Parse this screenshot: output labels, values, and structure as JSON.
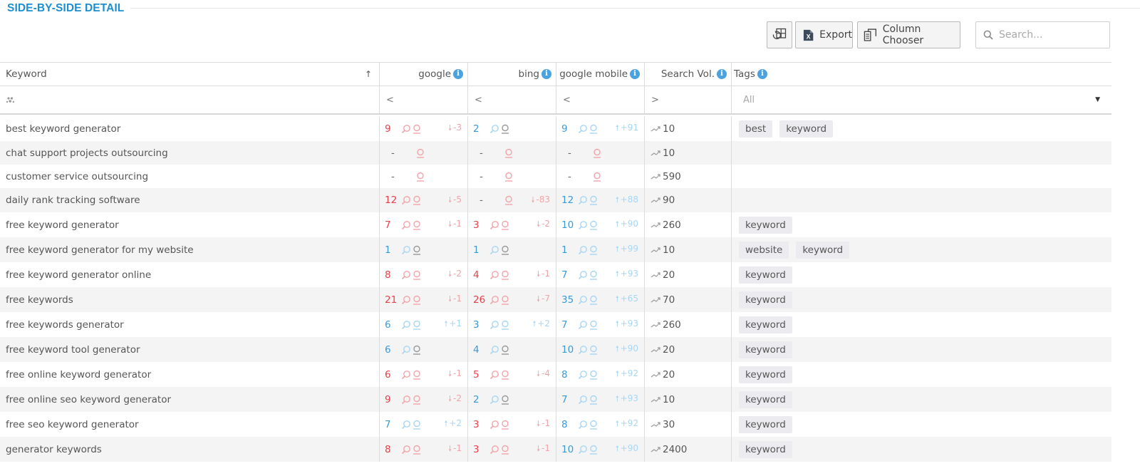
{
  "title": "SIDE-BY-SIDE DETAIL",
  "toolbar": {
    "export_label": "Export",
    "column_chooser_label": "Column Chooser",
    "search_placeholder": "Search..."
  },
  "colors": {
    "accent": "#1b8fd1",
    "worse": "#e8404a",
    "better": "#3a9ad9",
    "info": "#4aa3df"
  },
  "columns": {
    "keyword": "Keyword",
    "sort_indicator": "↑",
    "google": "google",
    "bing": "bing",
    "google_mobile": "google mobile",
    "search_vol": "Search Vol.",
    "tags": "Tags"
  },
  "filters": {
    "google": "<",
    "bing": "<",
    "google_mobile": "<",
    "search_vol": ">",
    "tags": "All"
  },
  "rows": [
    {
      "keyword": "best keyword generator",
      "google": {
        "rank": "9",
        "state": "red",
        "change": "-3",
        "dir": "down"
      },
      "bing": {
        "rank": "2",
        "state": "blue",
        "change": "",
        "dir": ""
      },
      "mobile": {
        "rank": "9",
        "state": "blue",
        "change": "+91",
        "dir": "up"
      },
      "vol": "10",
      "tags": [
        "best",
        "keyword"
      ]
    },
    {
      "keyword": "chat support projects outsourcing",
      "google": {
        "rank": "-",
        "state": "none",
        "change": "",
        "dir": ""
      },
      "bing": {
        "rank": "-",
        "state": "none",
        "change": "",
        "dir": ""
      },
      "mobile": {
        "rank": "-",
        "state": "none",
        "change": "",
        "dir": ""
      },
      "vol": "10",
      "tags": []
    },
    {
      "keyword": "customer service outsourcing",
      "google": {
        "rank": "-",
        "state": "none",
        "change": "",
        "dir": ""
      },
      "bing": {
        "rank": "-",
        "state": "none",
        "change": "",
        "dir": ""
      },
      "mobile": {
        "rank": "-",
        "state": "none",
        "change": "",
        "dir": ""
      },
      "vol": "590",
      "tags": []
    },
    {
      "keyword": "daily rank tracking software",
      "google": {
        "rank": "12",
        "state": "red",
        "change": "-5",
        "dir": "down"
      },
      "bing": {
        "rank": "-",
        "state": "none",
        "change": "-83",
        "dir": "down"
      },
      "mobile": {
        "rank": "12",
        "state": "blue",
        "change": "+88",
        "dir": "up"
      },
      "vol": "90",
      "tags": []
    },
    {
      "keyword": "free keyword generator",
      "google": {
        "rank": "7",
        "state": "red",
        "change": "-1",
        "dir": "down"
      },
      "bing": {
        "rank": "3",
        "state": "red",
        "change": "-2",
        "dir": "down"
      },
      "mobile": {
        "rank": "10",
        "state": "blue",
        "change": "+90",
        "dir": "up"
      },
      "vol": "260",
      "tags": [
        "keyword"
      ]
    },
    {
      "keyword": "free keyword generator for my website",
      "google": {
        "rank": "1",
        "state": "blue",
        "change": "",
        "dir": ""
      },
      "bing": {
        "rank": "1",
        "state": "blue",
        "change": "",
        "dir": ""
      },
      "mobile": {
        "rank": "1",
        "state": "blue",
        "change": "+99",
        "dir": "up"
      },
      "vol": "10",
      "tags": [
        "website",
        "keyword"
      ]
    },
    {
      "keyword": "free keyword generator online",
      "google": {
        "rank": "8",
        "state": "red",
        "change": "-2",
        "dir": "down"
      },
      "bing": {
        "rank": "4",
        "state": "red",
        "change": "-1",
        "dir": "down"
      },
      "mobile": {
        "rank": "7",
        "state": "blue",
        "change": "+93",
        "dir": "up"
      },
      "vol": "20",
      "tags": [
        "keyword"
      ]
    },
    {
      "keyword": "free keywords",
      "google": {
        "rank": "21",
        "state": "red",
        "change": "-1",
        "dir": "down"
      },
      "bing": {
        "rank": "26",
        "state": "red",
        "change": "-7",
        "dir": "down"
      },
      "mobile": {
        "rank": "35",
        "state": "blue",
        "change": "+65",
        "dir": "up"
      },
      "vol": "70",
      "tags": [
        "keyword"
      ]
    },
    {
      "keyword": "free keywords generator",
      "google": {
        "rank": "6",
        "state": "blue",
        "change": "+1",
        "dir": "up"
      },
      "bing": {
        "rank": "3",
        "state": "blue",
        "change": "+2",
        "dir": "up"
      },
      "mobile": {
        "rank": "7",
        "state": "blue",
        "change": "+93",
        "dir": "up"
      },
      "vol": "260",
      "tags": [
        "keyword"
      ]
    },
    {
      "keyword": "free keyword tool generator",
      "google": {
        "rank": "6",
        "state": "blue",
        "change": "",
        "dir": ""
      },
      "bing": {
        "rank": "4",
        "state": "blue",
        "change": "",
        "dir": ""
      },
      "mobile": {
        "rank": "10",
        "state": "blue",
        "change": "+90",
        "dir": "up"
      },
      "vol": "20",
      "tags": [
        "keyword"
      ]
    },
    {
      "keyword": "free online keyword generator",
      "google": {
        "rank": "6",
        "state": "red",
        "change": "-1",
        "dir": "down"
      },
      "bing": {
        "rank": "5",
        "state": "red",
        "change": "-4",
        "dir": "down"
      },
      "mobile": {
        "rank": "8",
        "state": "blue",
        "change": "+92",
        "dir": "up"
      },
      "vol": "20",
      "tags": [
        "keyword"
      ]
    },
    {
      "keyword": "free online seo keyword generator",
      "google": {
        "rank": "9",
        "state": "red",
        "change": "-2",
        "dir": "down"
      },
      "bing": {
        "rank": "2",
        "state": "blue",
        "change": "",
        "dir": ""
      },
      "mobile": {
        "rank": "7",
        "state": "blue",
        "change": "+93",
        "dir": "up"
      },
      "vol": "10",
      "tags": [
        "keyword"
      ]
    },
    {
      "keyword": "free seo keyword generator",
      "google": {
        "rank": "7",
        "state": "blue",
        "change": "+2",
        "dir": "up"
      },
      "bing": {
        "rank": "3",
        "state": "red",
        "change": "-1",
        "dir": "down"
      },
      "mobile": {
        "rank": "8",
        "state": "blue",
        "change": "+92",
        "dir": "up"
      },
      "vol": "30",
      "tags": [
        "keyword"
      ]
    },
    {
      "keyword": "generator keywords",
      "google": {
        "rank": "8",
        "state": "red",
        "change": "-1",
        "dir": "down"
      },
      "bing": {
        "rank": "3",
        "state": "red",
        "change": "-1",
        "dir": "down"
      },
      "mobile": {
        "rank": "10",
        "state": "blue",
        "change": "+90",
        "dir": "up"
      },
      "vol": "2400",
      "tags": [
        "keyword"
      ]
    }
  ]
}
